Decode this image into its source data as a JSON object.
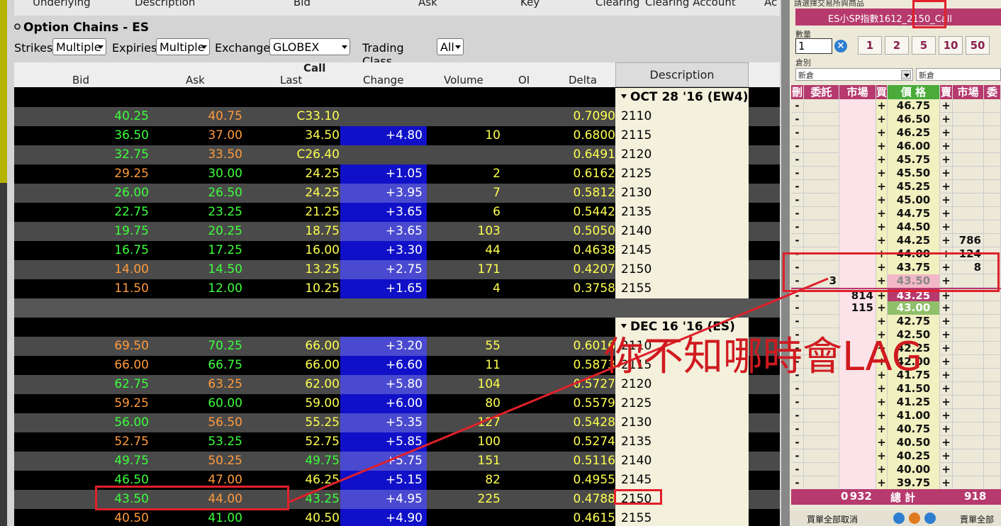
{
  "top_columns": [
    "Underlying",
    "Description",
    "Bid",
    "Ask",
    "Key",
    "Clearing",
    "Clearing Account",
    "Ac"
  ],
  "option_chains": {
    "title": "Option Chains - ES",
    "strikes_label": "Strikes",
    "strikes_value": "Multiple",
    "expiries_label": "Expiries",
    "expiries_value": "Multiple",
    "exchange_label": "Exchange",
    "exchange_value": "GLOBEX",
    "trading_class_label": "Trading Class",
    "trading_class_value": "All"
  },
  "grid_header": {
    "call": "Call",
    "bid": "Bid",
    "ask": "Ask",
    "last": "Last",
    "change": "Change",
    "volume": "Volume",
    "oi": "OI",
    "delta": "Delta",
    "description": "Description"
  },
  "groups": [
    {
      "label": "OCT 28 '16 (EW4)",
      "rows": [
        {
          "bid": "40.25",
          "ask": "40.75",
          "last": "C33.10",
          "change": "",
          "volume": "",
          "delta": "0.7090",
          "strike": "2110",
          "bc": "g",
          "ac": "o"
        },
        {
          "bid": "36.50",
          "ask": "37.00",
          "last": "34.50",
          "change": "+4.80",
          "volume": "10",
          "delta": "0.6800",
          "strike": "2115",
          "bc": "g",
          "ac": "o"
        },
        {
          "bid": "32.75",
          "ask": "33.50",
          "last": "C26.40",
          "change": "",
          "volume": "",
          "delta": "0.6491",
          "strike": "2120",
          "bc": "g",
          "ac": "o"
        },
        {
          "bid": "29.25",
          "ask": "30.00",
          "last": "24.25",
          "change": "+1.05",
          "volume": "2",
          "delta": "0.6162",
          "strike": "2125",
          "bc": "o",
          "ac": "g"
        },
        {
          "bid": "26.00",
          "ask": "26.50",
          "last": "24.25",
          "change": "+3.95",
          "volume": "7",
          "delta": "0.5812",
          "strike": "2130",
          "bc": "g",
          "ac": "g"
        },
        {
          "bid": "22.75",
          "ask": "23.25",
          "last": "21.25",
          "change": "+3.65",
          "volume": "6",
          "delta": "0.5442",
          "strike": "2135",
          "bc": "g",
          "ac": "g"
        },
        {
          "bid": "19.75",
          "ask": "20.25",
          "last": "18.75",
          "change": "+3.65",
          "volume": "103",
          "delta": "0.5050",
          "strike": "2140",
          "bc": "g",
          "ac": "g"
        },
        {
          "bid": "16.75",
          "ask": "17.25",
          "last": "16.00",
          "change": "+3.30",
          "volume": "44",
          "delta": "0.4638",
          "strike": "2145",
          "bc": "g",
          "ac": "g"
        },
        {
          "bid": "14.00",
          "ask": "14.50",
          "last": "13.25",
          "change": "+2.75",
          "volume": "171",
          "delta": "0.4207",
          "strike": "2150",
          "bc": "o",
          "ac": "g"
        },
        {
          "bid": "11.50",
          "ask": "12.00",
          "last": "10.25",
          "change": "+1.65",
          "volume": "4",
          "delta": "0.3758",
          "strike": "2155",
          "bc": "o",
          "ac": "g"
        }
      ]
    },
    {
      "label": "DEC 16 '16 (ES)",
      "rows": [
        {
          "bid": "69.50",
          "ask": "70.25",
          "last": "66.00",
          "change": "+3.20",
          "volume": "55",
          "delta": "0.6016",
          "strike": "2110",
          "bc": "o",
          "ac": "g"
        },
        {
          "bid": "66.00",
          "ask": "66.75",
          "last": "66.00",
          "change": "+6.60",
          "volume": "11",
          "delta": "0.5873",
          "strike": "2115",
          "bc": "o",
          "ac": "g"
        },
        {
          "bid": "62.75",
          "ask": "63.25",
          "last": "62.00",
          "change": "+5.80",
          "volume": "104",
          "delta": "0.5727",
          "strike": "2120",
          "bc": "g",
          "ac": "o"
        },
        {
          "bid": "59.25",
          "ask": "60.00",
          "last": "59.00",
          "change": "+6.00",
          "volume": "80",
          "delta": "0.5579",
          "strike": "2125",
          "bc": "o",
          "ac": "g"
        },
        {
          "bid": "56.00",
          "ask": "56.50",
          "last": "55.25",
          "change": "+5.35",
          "volume": "127",
          "delta": "0.5428",
          "strike": "2130",
          "bc": "g",
          "ac": "o"
        },
        {
          "bid": "52.75",
          "ask": "53.25",
          "last": "52.75",
          "change": "+5.85",
          "volume": "100",
          "delta": "0.5274",
          "strike": "2135",
          "bc": "o",
          "ac": "g"
        },
        {
          "bid": "49.75",
          "ask": "50.25",
          "last": "49.75",
          "change": "+5.75",
          "volume": "151",
          "delta": "0.5116",
          "strike": "2140",
          "bc": "g",
          "ac": "o"
        },
        {
          "bid": "46.50",
          "ask": "47.00",
          "last": "46.25",
          "change": "+5.15",
          "volume": "82",
          "delta": "0.4955",
          "strike": "2145",
          "bc": "g",
          "ac": "o"
        },
        {
          "bid": "43.50",
          "ask": "44.00",
          "last": "43.25",
          "change": "+4.95",
          "volume": "225",
          "delta": "0.4788",
          "strike": "2150",
          "bc": "g",
          "ac": "o"
        },
        {
          "bid": "40.50",
          "ask": "41.00",
          "last": "40.50",
          "change": "+4.90",
          "volume": "",
          "delta": "0.4615",
          "strike": "2155",
          "bc": "o",
          "ac": "g"
        }
      ]
    }
  ],
  "right_panel": {
    "select_label": "請選擇交易所與商品",
    "contract": "ES小SP指數1612_2150_Call",
    "qty_label": "數量",
    "qty_value": "1",
    "qty_clear": "×",
    "qty_buttons": [
      "1",
      "2",
      "5",
      "10",
      "50"
    ],
    "category_label": "倉別",
    "category_value": "新倉",
    "category_value2": "新倉",
    "ladder_headers": [
      "刪",
      "委託",
      "市場",
      "買",
      "價 格",
      "賣",
      "市場",
      "委"
    ],
    "ladder": [
      {
        "price": "46.75",
        "bmk": "",
        "smk": "",
        "bq": ""
      },
      {
        "price": "46.50",
        "bmk": "",
        "smk": "",
        "bq": ""
      },
      {
        "price": "46.25",
        "bmk": "",
        "smk": "",
        "bq": ""
      },
      {
        "price": "46.00",
        "bmk": "",
        "smk": "",
        "bq": ""
      },
      {
        "price": "45.75",
        "bmk": "",
        "smk": "",
        "bq": ""
      },
      {
        "price": "45.50",
        "bmk": "",
        "smk": "",
        "bq": ""
      },
      {
        "price": "45.25",
        "bmk": "",
        "smk": "",
        "bq": ""
      },
      {
        "price": "45.00",
        "bmk": "",
        "smk": "",
        "bq": ""
      },
      {
        "price": "44.75",
        "bmk": "",
        "smk": "",
        "bq": ""
      },
      {
        "price": "44.50",
        "bmk": "",
        "smk": "",
        "bq": ""
      },
      {
        "price": "44.25",
        "bmk": "",
        "smk": "786",
        "bq": ""
      },
      {
        "price": "44.00",
        "bmk": "",
        "smk": "124",
        "bq": ""
      },
      {
        "price": "43.75",
        "bmk": "",
        "smk": "8",
        "bq": ""
      },
      {
        "price": "43.50",
        "bmk": "",
        "smk": "",
        "bq": "3"
      },
      {
        "price": "43.25",
        "bmk": "814",
        "smk": "",
        "bq": ""
      },
      {
        "price": "43.00",
        "bmk": "115",
        "smk": "",
        "bq": ""
      },
      {
        "price": "42.75",
        "bmk": "",
        "smk": "",
        "bq": ""
      },
      {
        "price": "42.50",
        "bmk": "",
        "smk": "",
        "bq": ""
      },
      {
        "price": "42.25",
        "bmk": "",
        "smk": "",
        "bq": ""
      },
      {
        "price": "42.00",
        "bmk": "",
        "smk": "",
        "bq": ""
      },
      {
        "price": "41.75",
        "bmk": "",
        "smk": "",
        "bq": ""
      },
      {
        "price": "41.50",
        "bmk": "",
        "smk": "",
        "bq": ""
      },
      {
        "price": "41.25",
        "bmk": "",
        "smk": "",
        "bq": ""
      },
      {
        "price": "41.00",
        "bmk": "",
        "smk": "",
        "bq": ""
      },
      {
        "price": "40.75",
        "bmk": "",
        "smk": "",
        "bq": ""
      },
      {
        "price": "40.50",
        "bmk": "",
        "smk": "",
        "bq": ""
      },
      {
        "price": "40.25",
        "bmk": "",
        "smk": "",
        "bq": ""
      },
      {
        "price": "40.00",
        "bmk": "",
        "smk": "",
        "bq": ""
      },
      {
        "price": "39.75",
        "bmk": "",
        "smk": "",
        "bq": ""
      }
    ],
    "total_left": "0",
    "total_buy": "932",
    "total_label": "總 計",
    "total_sell": "918",
    "cancel_buy_all": "買單全部取消",
    "cancel_sell_all": "賣單全部"
  },
  "annotation": "你不知哪時會LAG",
  "colors": {
    "brand": "#b63a6e",
    "annot": "#d01a20",
    "change_bg": "#1010c8"
  }
}
